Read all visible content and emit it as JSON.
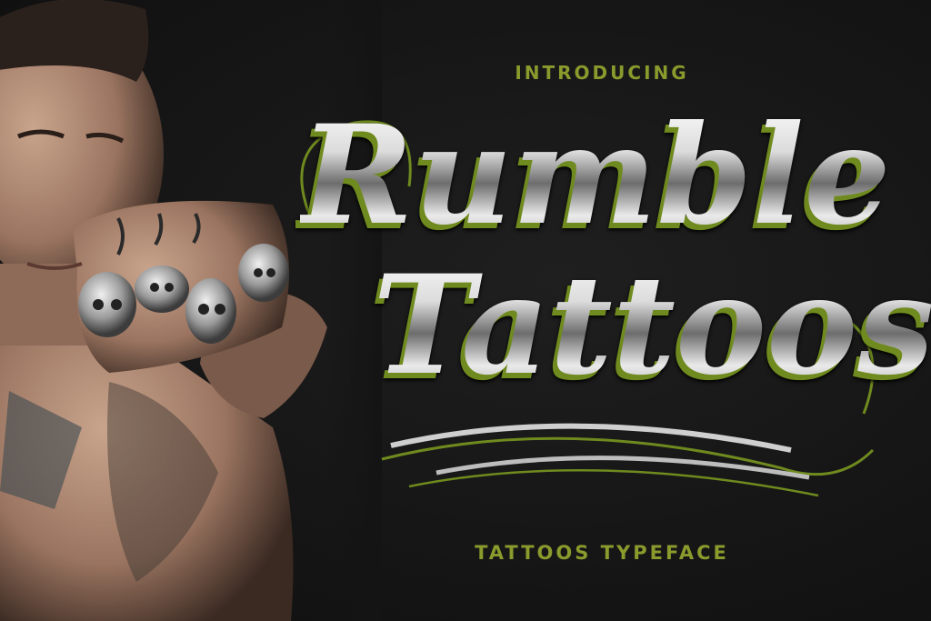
{
  "header": {
    "intro_label": "INTRODUCING"
  },
  "title": {
    "line1": "Rumble",
    "line2": "Tattoos"
  },
  "footer": {
    "subtitle": "TATTOOS TYPEFACE"
  },
  "colors": {
    "accent_green": "#8a9a2c",
    "background": "#141414",
    "chrome_light": "#e6e6e6"
  },
  "images": {
    "photo": "tattooed man with skull rings holding fist toward camera"
  }
}
